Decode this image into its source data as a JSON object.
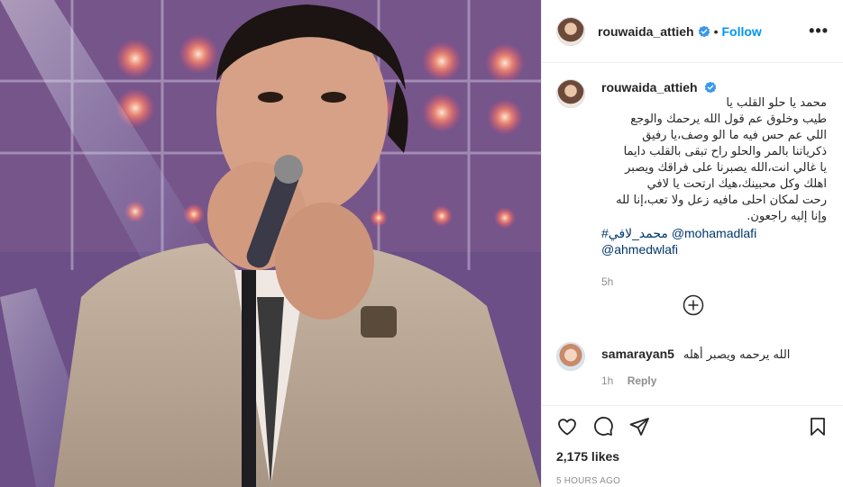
{
  "photo": {
    "description_icon": "singer-photo"
  },
  "header": {
    "username": "rouwaida_attieh",
    "dot": "•",
    "follow_label": "Follow",
    "more_label": "•••"
  },
  "caption": {
    "username": "rouwaida_attieh",
    "lines": [
      "محمد يا حلو القلب يا",
      "طيب وخلوق عم قول الله يرحمك والوجع",
      "اللي عم حس فيه ما الو وصف،يا رفيق",
      "ذكرياتنا بالمر والحلو راح تبقى بالقلب دايما",
      "يا غالي انت،الله يصبرنا على فراقك ويصبر",
      "اهلك وكل محبينك،هيك ارتحت يا لافي",
      "رحت لمكان احلى مافيه زعل ولا تعب،إنا لله",
      "وإنا إليه راجعون."
    ],
    "tag_hashtag": "#محمد_لافي",
    "tag_mention1": "@mohamadlafi",
    "tag_mention2": "@ahmedwlafi",
    "time": "5h"
  },
  "comment": {
    "username": "samarayan5",
    "text": "الله يرحمه ويصبر أهله",
    "time": "1h",
    "reply_label": "Reply"
  },
  "stats": {
    "likes": "2,175 likes",
    "posted": "5 HOURS AGO"
  },
  "colors": {
    "accent": "#0095f6",
    "verified": "#3897f0",
    "link": "#00376b",
    "muted": "#8e8e8e"
  }
}
